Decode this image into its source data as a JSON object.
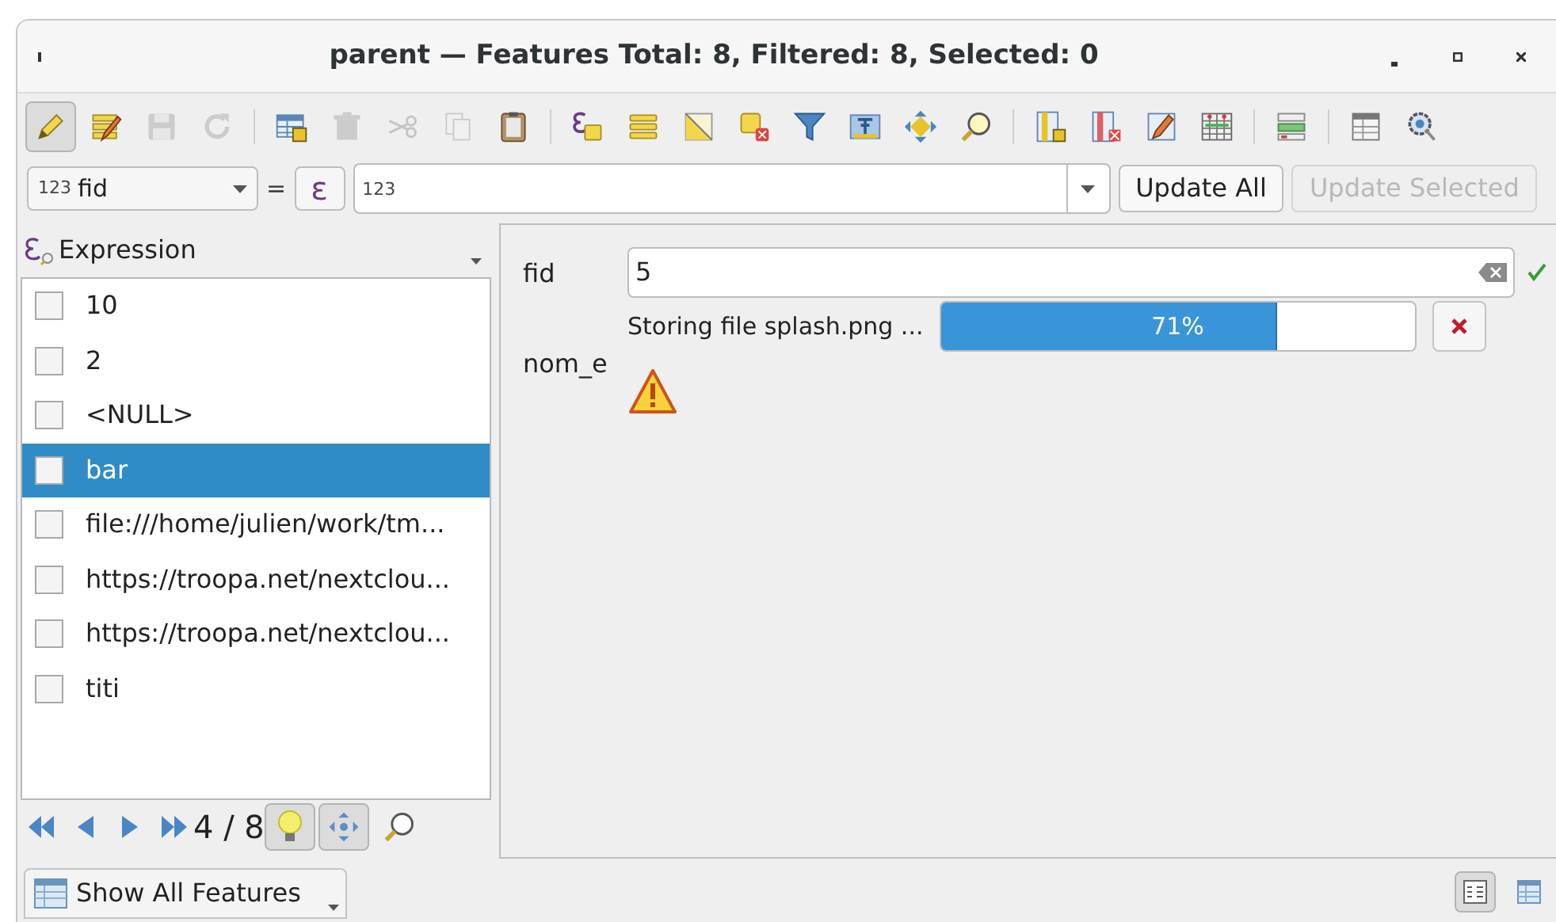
{
  "window": {
    "title": "parent — Features Total: 8, Filtered: 8, Selected: 0"
  },
  "toolbar": [
    {
      "kind": "pencil",
      "pressed": true,
      "disabled": false
    },
    {
      "kind": "multi-edit",
      "pressed": false,
      "disabled": false
    },
    {
      "kind": "save",
      "pressed": false,
      "disabled": true
    },
    {
      "kind": "refresh",
      "pressed": false,
      "disabled": true
    },
    {
      "kind": "separator"
    },
    {
      "kind": "add-row",
      "pressed": false,
      "disabled": false
    },
    {
      "kind": "trash",
      "pressed": false,
      "disabled": true
    },
    {
      "kind": "scissors",
      "pressed": false,
      "disabled": true
    },
    {
      "kind": "copy",
      "pressed": false,
      "disabled": true
    },
    {
      "kind": "clipboard",
      "pressed": false,
      "disabled": false
    },
    {
      "kind": "separator"
    },
    {
      "kind": "expression-select",
      "pressed": false,
      "disabled": false
    },
    {
      "kind": "rows",
      "pressed": false,
      "disabled": false
    },
    {
      "kind": "invert",
      "pressed": false,
      "disabled": false
    },
    {
      "kind": "deselect",
      "pressed": false,
      "disabled": false
    },
    {
      "kind": "filter",
      "pressed": false,
      "disabled": false
    },
    {
      "kind": "table-pin",
      "pressed": false,
      "disabled": false
    },
    {
      "kind": "pan",
      "pressed": false,
      "disabled": false
    },
    {
      "kind": "zoom",
      "pressed": false,
      "disabled": false
    },
    {
      "kind": "separator"
    },
    {
      "kind": "add-column",
      "pressed": false,
      "disabled": false
    },
    {
      "kind": "delete-column",
      "pressed": false,
      "disabled": false
    },
    {
      "kind": "pencil-table",
      "pressed": false,
      "disabled": false
    },
    {
      "kind": "grid",
      "pressed": false,
      "disabled": false
    },
    {
      "kind": "separator"
    },
    {
      "kind": "form-rows",
      "pressed": false,
      "disabled": false
    },
    {
      "kind": "separator"
    },
    {
      "kind": "window",
      "pressed": false,
      "disabled": false
    },
    {
      "kind": "search-gear",
      "pressed": false,
      "disabled": false
    }
  ],
  "filter_bar": {
    "field": {
      "type_badge": "123",
      "value": "fid"
    },
    "operator": "=",
    "expression_button": "ε",
    "value_field": {
      "placeholder": "123"
    },
    "buttons": [
      {
        "label": "Update All",
        "disabled": false
      },
      {
        "label": "Update Selected",
        "disabled": true
      }
    ]
  },
  "list_panel": {
    "header": "Expression",
    "items": [
      {
        "label": "10",
        "checked": false,
        "selected": false
      },
      {
        "label": "2",
        "checked": false,
        "selected": false
      },
      {
        "label": "<NULL>",
        "checked": false,
        "selected": false
      },
      {
        "label": "bar",
        "checked": false,
        "selected": true
      },
      {
        "label": "file:///home/julien/work/tm...",
        "checked": false,
        "selected": false
      },
      {
        "label": "https://troopa.net/nextclou...",
        "checked": false,
        "selected": false
      },
      {
        "label": "https://troopa.net/nextclou...",
        "checked": false,
        "selected": false
      },
      {
        "label": "titi",
        "checked": false,
        "selected": false
      }
    ],
    "navigation": {
      "position": "4 / 8",
      "highlight_on": true,
      "pan_on": true
    }
  },
  "form": {
    "fields": [
      {
        "kind": "text",
        "label": "fid",
        "value": "5",
        "valid": true
      },
      {
        "kind": "upload",
        "label": "nom_e",
        "status": "Storing file splash.png ...",
        "level": 0.71,
        "reading": "71%",
        "warning": true
      }
    ]
  },
  "bottom_bar": {
    "filter_button": "Show All Features",
    "views": [
      {
        "kind": "form",
        "selected": true
      },
      {
        "kind": "table",
        "selected": false
      }
    ]
  }
}
